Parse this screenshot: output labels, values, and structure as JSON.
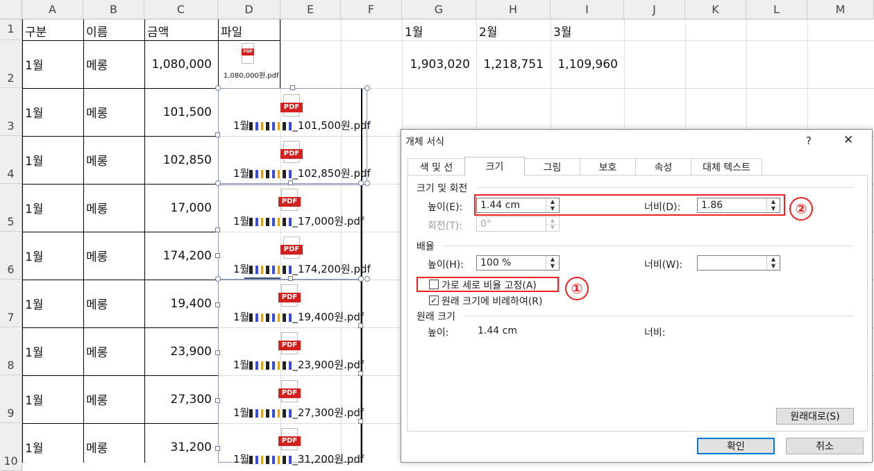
{
  "sheet": {
    "columns": [
      "A",
      "B",
      "C",
      "D",
      "E",
      "F",
      "G",
      "H",
      "I",
      "J",
      "K",
      "L",
      "M"
    ],
    "rows": [
      "1",
      "2",
      "3",
      "4",
      "5",
      "6",
      "7",
      "8",
      "9",
      "10"
    ],
    "headers": {
      "A": "구분",
      "B": "이름",
      "C": "금액",
      "D": "파일",
      "G": "1월",
      "H": "2월",
      "I": "3월"
    },
    "data_rows": [
      {
        "month": "1월",
        "name": "메롱",
        "amount": "1,080,000",
        "file": "1,080,000원.pdf"
      },
      {
        "month": "1월",
        "name": "메롱",
        "amount": "101,500",
        "file": "_101,500원.pdf"
      },
      {
        "month": "1월",
        "name": "메롱",
        "amount": "102,850",
        "file": "_102,850원.pdf"
      },
      {
        "month": "1월",
        "name": "메롱",
        "amount": "17,000",
        "file": "_17,000원.pdf"
      },
      {
        "month": "1월",
        "name": "메롱",
        "amount": "174,200",
        "file": "_174,200원.pdf"
      },
      {
        "month": "1월",
        "name": "메롱",
        "amount": "19,400",
        "file": "_19,400원.pdf"
      },
      {
        "month": "1월",
        "name": "메롱",
        "amount": "23,900",
        "file": "_23,900원.pdf"
      },
      {
        "month": "1월",
        "name": "메롱",
        "amount": "27,300",
        "file": "_27,300원.pdf"
      },
      {
        "month": "1월",
        "name": "메롱",
        "amount": "31,200",
        "file": "_31,200원.pdf"
      }
    ],
    "totals": {
      "G": "1,903,020",
      "H": "1,218,751",
      "I": "1,109,960"
    },
    "pdf_label": "PDF",
    "file_prefix": "1월"
  },
  "dialog": {
    "title": "개체 서식",
    "help": "?",
    "close": "✕",
    "tabs": [
      "색 및 선",
      "크기",
      "그림",
      "보호",
      "속성",
      "대체 텍스트"
    ],
    "active_tab": "크기",
    "size_rotate": {
      "group": "크기 및 회전",
      "height_label": "높이(E):",
      "height_value": "1.44 cm",
      "width_label": "너비(D):",
      "width_value": "1.86",
      "rotation_label": "회전(T):",
      "rotation_value": "0°"
    },
    "scale": {
      "group": "배율",
      "height_label": "높이(H):",
      "height_value": "100 %",
      "width_label": "너비(W):",
      "width_value": ""
    },
    "lock_aspect": {
      "label": "가로 세로 비율 고정(A)",
      "checked": false
    },
    "relative_original": {
      "label": "원래 크기에 비례하여(R)",
      "checked": true
    },
    "original": {
      "group": "원래 크기",
      "height_label": "높이:",
      "height_value": "1.44 cm",
      "width_label": "너비:",
      "width_value": ""
    },
    "reset_button": "원래대로(S)",
    "ok_button": "확인",
    "cancel_button": "취소"
  },
  "annotations": {
    "badge_1": "①",
    "badge_2": "②"
  },
  "colors": {
    "annotation": "#ee2222",
    "pdf_red": "#d21f1f",
    "ok_border": "#0078d7"
  }
}
